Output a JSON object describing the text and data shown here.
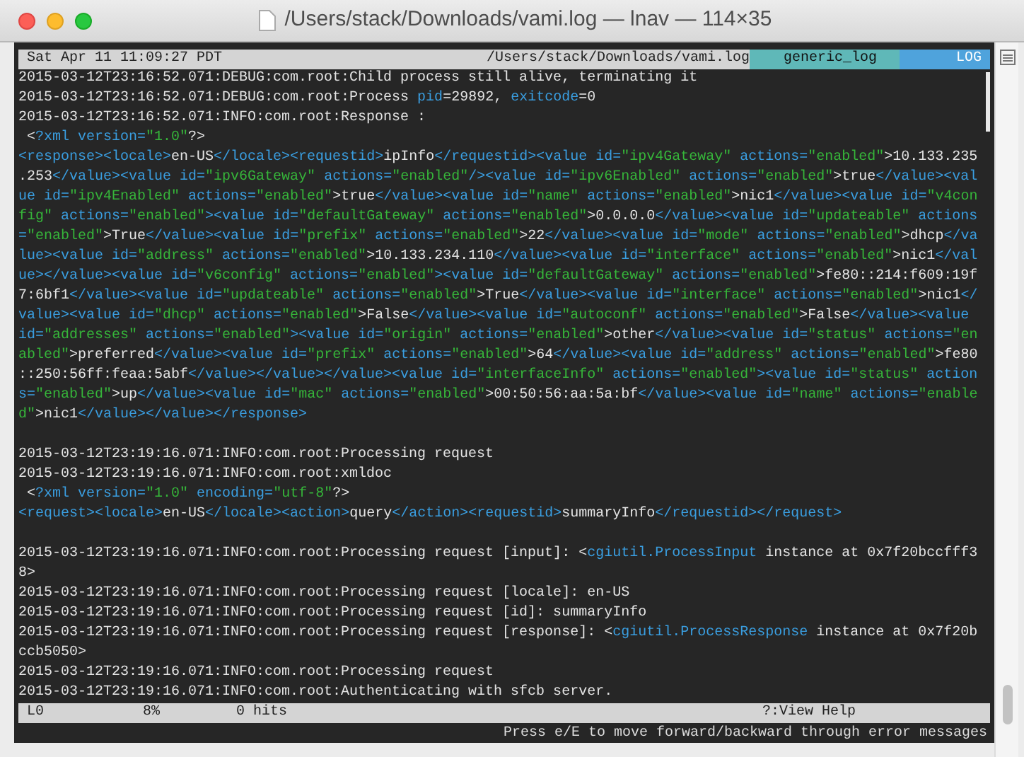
{
  "window": {
    "title": "/Users/stack/Downloads/vami.log — lnav — 114×35"
  },
  "top_bar": {
    "clock": "Sat Apr 11 11:09:27 PDT",
    "file": "/Users/stack/Downloads/vami.log",
    "format": "generic_log",
    "view": "LOG"
  },
  "lines": [
    {
      "segments": [
        {
          "kind": "plain",
          "text": "2015-03-12T23:16:52.071:DEBUG:com.root:Child process still alive, terminating it"
        }
      ]
    },
    {
      "segments": [
        {
          "kind": "plain",
          "text": "2015-03-12T23:16:52.071:DEBUG:com.root:Process "
        },
        {
          "kind": "name",
          "text": "pid"
        },
        {
          "kind": "plain",
          "text": "=29892, "
        },
        {
          "kind": "name",
          "text": "exitcode"
        },
        {
          "kind": "plain",
          "text": "=0"
        }
      ]
    },
    {
      "segments": [
        {
          "kind": "plain",
          "text": "2015-03-12T23:16:52.071:INFO:com.root:Response :"
        }
      ]
    },
    {
      "segments": [
        {
          "kind": "plain",
          "text": " <"
        },
        {
          "kind": "name",
          "text": "?xml version="
        },
        {
          "kind": "string",
          "text": "\"1.0\""
        },
        {
          "kind": "plain",
          "text": "?>"
        }
      ]
    },
    {
      "segments": [
        {
          "kind": "name",
          "text": "<response><locale>"
        },
        {
          "kind": "plain",
          "text": "en-US"
        },
        {
          "kind": "name",
          "text": "</locale><requestid>"
        },
        {
          "kind": "plain",
          "text": "ipInfo"
        },
        {
          "kind": "name",
          "text": "</requestid><value id="
        },
        {
          "kind": "string",
          "text": "\"ipv4Gateway\""
        },
        {
          "kind": "name",
          "text": " actions="
        },
        {
          "kind": "string",
          "text": "\"enabled\""
        },
        {
          "kind": "plain",
          "text": ">10.133.235"
        }
      ]
    },
    {
      "segments": [
        {
          "kind": "plain",
          "text": ".253"
        },
        {
          "kind": "name",
          "text": "</value><value id="
        },
        {
          "kind": "string",
          "text": "\"ipv6Gateway\""
        },
        {
          "kind": "name",
          "text": " actions="
        },
        {
          "kind": "string",
          "text": "\"enabled\""
        },
        {
          "kind": "name",
          "text": "/><value id="
        },
        {
          "kind": "string",
          "text": "\"ipv6Enabled\""
        },
        {
          "kind": "name",
          "text": " actions="
        },
        {
          "kind": "string",
          "text": "\"enabled\""
        },
        {
          "kind": "plain",
          "text": ">true"
        },
        {
          "kind": "name",
          "text": "</value><val"
        }
      ]
    },
    {
      "segments": [
        {
          "kind": "name",
          "text": "ue id="
        },
        {
          "kind": "string",
          "text": "\"ipv4Enabled\""
        },
        {
          "kind": "name",
          "text": " actions="
        },
        {
          "kind": "string",
          "text": "\"enabled\""
        },
        {
          "kind": "plain",
          "text": ">true"
        },
        {
          "kind": "name",
          "text": "</value><value id="
        },
        {
          "kind": "string",
          "text": "\"name\""
        },
        {
          "kind": "name",
          "text": " actions="
        },
        {
          "kind": "string",
          "text": "\"enabled\""
        },
        {
          "kind": "plain",
          "text": ">nic1"
        },
        {
          "kind": "name",
          "text": "</value><value id="
        },
        {
          "kind": "string",
          "text": "\"v4con"
        }
      ]
    },
    {
      "segments": [
        {
          "kind": "string",
          "text": "fig\""
        },
        {
          "kind": "name",
          "text": " actions="
        },
        {
          "kind": "string",
          "text": "\"enabled\""
        },
        {
          "kind": "name",
          "text": "><value id="
        },
        {
          "kind": "string",
          "text": "\"defaultGateway\""
        },
        {
          "kind": "name",
          "text": " actions="
        },
        {
          "kind": "string",
          "text": "\"enabled\""
        },
        {
          "kind": "plain",
          "text": ">0.0.0.0"
        },
        {
          "kind": "name",
          "text": "</value><value id="
        },
        {
          "kind": "string",
          "text": "\"updateable\""
        },
        {
          "kind": "name",
          "text": " actions"
        }
      ]
    },
    {
      "segments": [
        {
          "kind": "name",
          "text": "="
        },
        {
          "kind": "string",
          "text": "\"enabled\""
        },
        {
          "kind": "plain",
          "text": ">True"
        },
        {
          "kind": "name",
          "text": "</value><value id="
        },
        {
          "kind": "string",
          "text": "\"prefix\""
        },
        {
          "kind": "name",
          "text": " actions="
        },
        {
          "kind": "string",
          "text": "\"enabled\""
        },
        {
          "kind": "plain",
          "text": ">22"
        },
        {
          "kind": "name",
          "text": "</value><value id="
        },
        {
          "kind": "string",
          "text": "\"mode\""
        },
        {
          "kind": "name",
          "text": " actions="
        },
        {
          "kind": "string",
          "text": "\"enabled\""
        },
        {
          "kind": "plain",
          "text": ">dhcp"
        },
        {
          "kind": "name",
          "text": "</va"
        }
      ]
    },
    {
      "segments": [
        {
          "kind": "name",
          "text": "lue><value id="
        },
        {
          "kind": "string",
          "text": "\"address\""
        },
        {
          "kind": "name",
          "text": " actions="
        },
        {
          "kind": "string",
          "text": "\"enabled\""
        },
        {
          "kind": "plain",
          "text": ">10.133.234.110"
        },
        {
          "kind": "name",
          "text": "</value><value id="
        },
        {
          "kind": "string",
          "text": "\"interface\""
        },
        {
          "kind": "name",
          "text": " actions="
        },
        {
          "kind": "string",
          "text": "\"enabled\""
        },
        {
          "kind": "plain",
          "text": ">nic1"
        },
        {
          "kind": "name",
          "text": "</val"
        }
      ]
    },
    {
      "segments": [
        {
          "kind": "name",
          "text": "ue></value><value id="
        },
        {
          "kind": "string",
          "text": "\"v6config\""
        },
        {
          "kind": "name",
          "text": " actions="
        },
        {
          "kind": "string",
          "text": "\"enabled\""
        },
        {
          "kind": "name",
          "text": "><value id="
        },
        {
          "kind": "string",
          "text": "\"defaultGateway\""
        },
        {
          "kind": "name",
          "text": " actions="
        },
        {
          "kind": "string",
          "text": "\"enabled\""
        },
        {
          "kind": "plain",
          "text": ">fe80::214:f609:19f"
        }
      ]
    },
    {
      "segments": [
        {
          "kind": "plain",
          "text": "7:6bf1"
        },
        {
          "kind": "name",
          "text": "</value><value id="
        },
        {
          "kind": "string",
          "text": "\"updateable\""
        },
        {
          "kind": "name",
          "text": " actions="
        },
        {
          "kind": "string",
          "text": "\"enabled\""
        },
        {
          "kind": "plain",
          "text": ">True"
        },
        {
          "kind": "name",
          "text": "</value><value id="
        },
        {
          "kind": "string",
          "text": "\"interface\""
        },
        {
          "kind": "name",
          "text": " actions="
        },
        {
          "kind": "string",
          "text": "\"enabled\""
        },
        {
          "kind": "plain",
          "text": ">nic1"
        },
        {
          "kind": "name",
          "text": "</"
        }
      ]
    },
    {
      "segments": [
        {
          "kind": "name",
          "text": "value><value id="
        },
        {
          "kind": "string",
          "text": "\"dhcp\""
        },
        {
          "kind": "name",
          "text": " actions="
        },
        {
          "kind": "string",
          "text": "\"enabled\""
        },
        {
          "kind": "plain",
          "text": ">False"
        },
        {
          "kind": "name",
          "text": "</value><value id="
        },
        {
          "kind": "string",
          "text": "\"autoconf\""
        },
        {
          "kind": "name",
          "text": " actions="
        },
        {
          "kind": "string",
          "text": "\"enabled\""
        },
        {
          "kind": "plain",
          "text": ">False"
        },
        {
          "kind": "name",
          "text": "</value><value"
        }
      ]
    },
    {
      "segments": [
        {
          "kind": "name",
          "text": "id="
        },
        {
          "kind": "string",
          "text": "\"addresses\""
        },
        {
          "kind": "name",
          "text": " actions="
        },
        {
          "kind": "string",
          "text": "\"enabled\""
        },
        {
          "kind": "name",
          "text": "><value id="
        },
        {
          "kind": "string",
          "text": "\"origin\""
        },
        {
          "kind": "name",
          "text": " actions="
        },
        {
          "kind": "string",
          "text": "\"enabled\""
        },
        {
          "kind": "plain",
          "text": ">other"
        },
        {
          "kind": "name",
          "text": "</value><value id="
        },
        {
          "kind": "string",
          "text": "\"status\""
        },
        {
          "kind": "name",
          "text": " actions="
        },
        {
          "kind": "string",
          "text": "\"en"
        }
      ]
    },
    {
      "segments": [
        {
          "kind": "string",
          "text": "abled\""
        },
        {
          "kind": "plain",
          "text": ">preferred"
        },
        {
          "kind": "name",
          "text": "</value><value id="
        },
        {
          "kind": "string",
          "text": "\"prefix\""
        },
        {
          "kind": "name",
          "text": " actions="
        },
        {
          "kind": "string",
          "text": "\"enabled\""
        },
        {
          "kind": "plain",
          "text": ">64"
        },
        {
          "kind": "name",
          "text": "</value><value id="
        },
        {
          "kind": "string",
          "text": "\"address\""
        },
        {
          "kind": "name",
          "text": " actions="
        },
        {
          "kind": "string",
          "text": "\"enabled\""
        },
        {
          "kind": "plain",
          "text": ">fe80"
        }
      ]
    },
    {
      "segments": [
        {
          "kind": "plain",
          "text": "::250:56ff:feaa:5abf"
        },
        {
          "kind": "name",
          "text": "</value></value></value><value id="
        },
        {
          "kind": "string",
          "text": "\"interfaceInfo\""
        },
        {
          "kind": "name",
          "text": " actions="
        },
        {
          "kind": "string",
          "text": "\"enabled\""
        },
        {
          "kind": "name",
          "text": "><value id="
        },
        {
          "kind": "string",
          "text": "\"status\""
        },
        {
          "kind": "name",
          "text": " action"
        }
      ]
    },
    {
      "segments": [
        {
          "kind": "name",
          "text": "s="
        },
        {
          "kind": "string",
          "text": "\"enabled\""
        },
        {
          "kind": "plain",
          "text": ">up"
        },
        {
          "kind": "name",
          "text": "</value><value id="
        },
        {
          "kind": "string",
          "text": "\"mac\""
        },
        {
          "kind": "name",
          "text": " actions="
        },
        {
          "kind": "string",
          "text": "\"enabled\""
        },
        {
          "kind": "plain",
          "text": ">00:50:56:aa:5a:bf"
        },
        {
          "kind": "name",
          "text": "</value><value id="
        },
        {
          "kind": "string",
          "text": "\"name\""
        },
        {
          "kind": "name",
          "text": " actions="
        },
        {
          "kind": "string",
          "text": "\"enable"
        }
      ]
    },
    {
      "segments": [
        {
          "kind": "string",
          "text": "d\""
        },
        {
          "kind": "plain",
          "text": ">nic1"
        },
        {
          "kind": "name",
          "text": "</value></value></response>"
        }
      ]
    },
    {
      "gap_before": true,
      "segments": [
        {
          "kind": "plain",
          "text": "2015-03-12T23:19:16.071:INFO:com.root:Processing request"
        }
      ]
    },
    {
      "segments": [
        {
          "kind": "plain",
          "text": "2015-03-12T23:19:16.071:INFO:com.root:xmldoc"
        }
      ]
    },
    {
      "segments": [
        {
          "kind": "plain",
          "text": " <"
        },
        {
          "kind": "name",
          "text": "?xml version="
        },
        {
          "kind": "string",
          "text": "\"1.0\""
        },
        {
          "kind": "name",
          "text": " encoding="
        },
        {
          "kind": "string",
          "text": "\"utf-8\""
        },
        {
          "kind": "plain",
          "text": "?>"
        }
      ]
    },
    {
      "segments": [
        {
          "kind": "name",
          "text": "<request><locale>"
        },
        {
          "kind": "plain",
          "text": "en-US"
        },
        {
          "kind": "name",
          "text": "</locale><action>"
        },
        {
          "kind": "plain",
          "text": "query"
        },
        {
          "kind": "name",
          "text": "</action><requestid>"
        },
        {
          "kind": "plain",
          "text": "summaryInfo"
        },
        {
          "kind": "name",
          "text": "</requestid></request>"
        }
      ]
    },
    {
      "gap_before": true,
      "segments": [
        {
          "kind": "plain",
          "text": "2015-03-12T23:19:16.071:INFO:com.root:Processing request [input]: <"
        },
        {
          "kind": "name",
          "text": "cgiutil.ProcessInput"
        },
        {
          "kind": "plain",
          "text": " instance at 0x7f20bccfff3"
        }
      ]
    },
    {
      "segments": [
        {
          "kind": "plain",
          "text": "8>"
        }
      ]
    },
    {
      "segments": [
        {
          "kind": "plain",
          "text": "2015-03-12T23:19:16.071:INFO:com.root:Processing request [locale]: en-US"
        }
      ]
    },
    {
      "segments": [
        {
          "kind": "plain",
          "text": "2015-03-12T23:19:16.071:INFO:com.root:Processing request [id]: summaryInfo"
        }
      ]
    },
    {
      "segments": [
        {
          "kind": "plain",
          "text": "2015-03-12T23:19:16.071:INFO:com.root:Processing request [response]: <"
        },
        {
          "kind": "name",
          "text": "cgiutil.ProcessResponse"
        },
        {
          "kind": "plain",
          "text": " instance at 0x7f20b"
        }
      ]
    },
    {
      "segments": [
        {
          "kind": "plain",
          "text": "ccb5050>"
        }
      ]
    },
    {
      "segments": [
        {
          "kind": "plain",
          "text": "2015-03-12T23:19:16.071:INFO:com.root:Processing request"
        }
      ]
    },
    {
      "segments": [
        {
          "kind": "plain",
          "text": "2015-03-12T23:19:16.071:INFO:com.root:Authenticating with sfcb server."
        }
      ]
    }
  ],
  "bottom_bar": {
    "line": "L0",
    "percent": "8%",
    "hits": "0 hits",
    "help": "?:View Help"
  },
  "message": "Press e/E to move forward/backward through error messages"
}
